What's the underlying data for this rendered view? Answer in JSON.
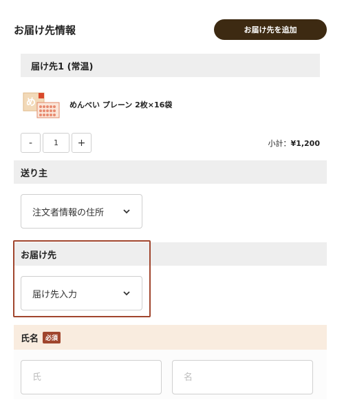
{
  "header": {
    "title": "お届け先情報",
    "add_button_label": "お届け先を追加"
  },
  "destination": {
    "label": "届け先1 (常温)"
  },
  "product": {
    "thumb_glyph": "め",
    "name": "めんべい プレーン 2枚×16袋"
  },
  "quantity": {
    "minus": "-",
    "value": "1",
    "plus": "+"
  },
  "subtotal": {
    "label": "小計：",
    "value": "¥1,200"
  },
  "sender": {
    "section_label": "送り主",
    "selected": "注文者情報の住所"
  },
  "recipient": {
    "section_label": "お届け先",
    "selected": "届け先入力"
  },
  "name": {
    "section_label": "氏名",
    "required_badge": "必須",
    "last_placeholder": "氏",
    "first_placeholder": "名"
  },
  "colors": {
    "accent": "#3d2a12",
    "highlight": "#a0452d",
    "section_bg": "#eeeeee",
    "required_bg": "#f9ecdf"
  }
}
